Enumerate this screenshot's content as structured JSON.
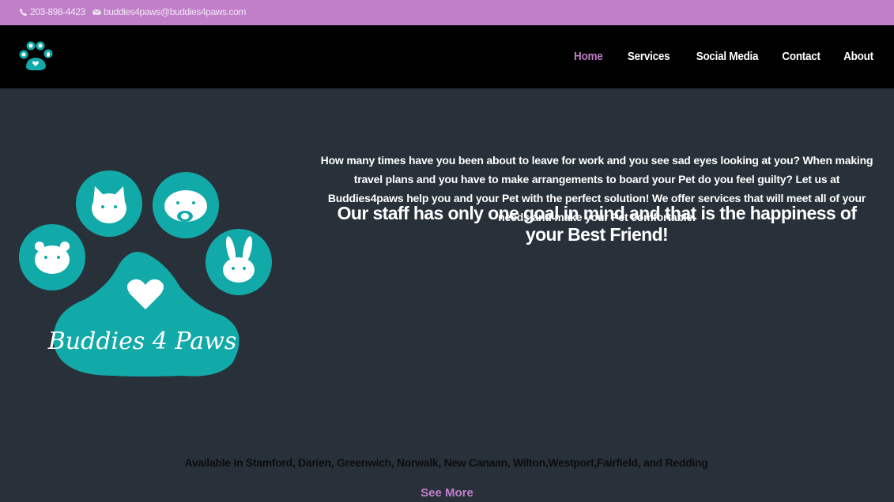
{
  "topbar": {
    "phone": "203-898-4423",
    "email": "buddies4paws@buddies4paws.com",
    "phone_icon": "phone-icon",
    "email_icon": "envelope-icon"
  },
  "nav": {
    "items": [
      "Home",
      "Services",
      "Social Media",
      "Contact",
      "About"
    ],
    "active": "Home"
  },
  "hero": {
    "logo_text": "Buddies 4 Paws",
    "intro": "How many times have you been about to leave for work and you see sad eyes looking at you? When making travel plans and you have to make arrangements to board your Pet do you feel guilty? Let us at Buddies4paws help you and your Pet with the perfect solution! We offer services that will meet all of your needs and make your Pet comfortable.",
    "goal": "Our staff has only one goal in mind and that is the happiness of your Best Friend!"
  },
  "availability": "Available in Stamford, Darien, Greenwich, Norwalk, New Canaan, Wilton,Westport,Fairfield, and Redding",
  "see_more": "See More",
  "colors": {
    "topbar": "#c17fc9",
    "accent": "#c17fc9",
    "nav_bg": "#000000",
    "body_bg": "#28313a",
    "brand_teal": "#12aaa8"
  }
}
